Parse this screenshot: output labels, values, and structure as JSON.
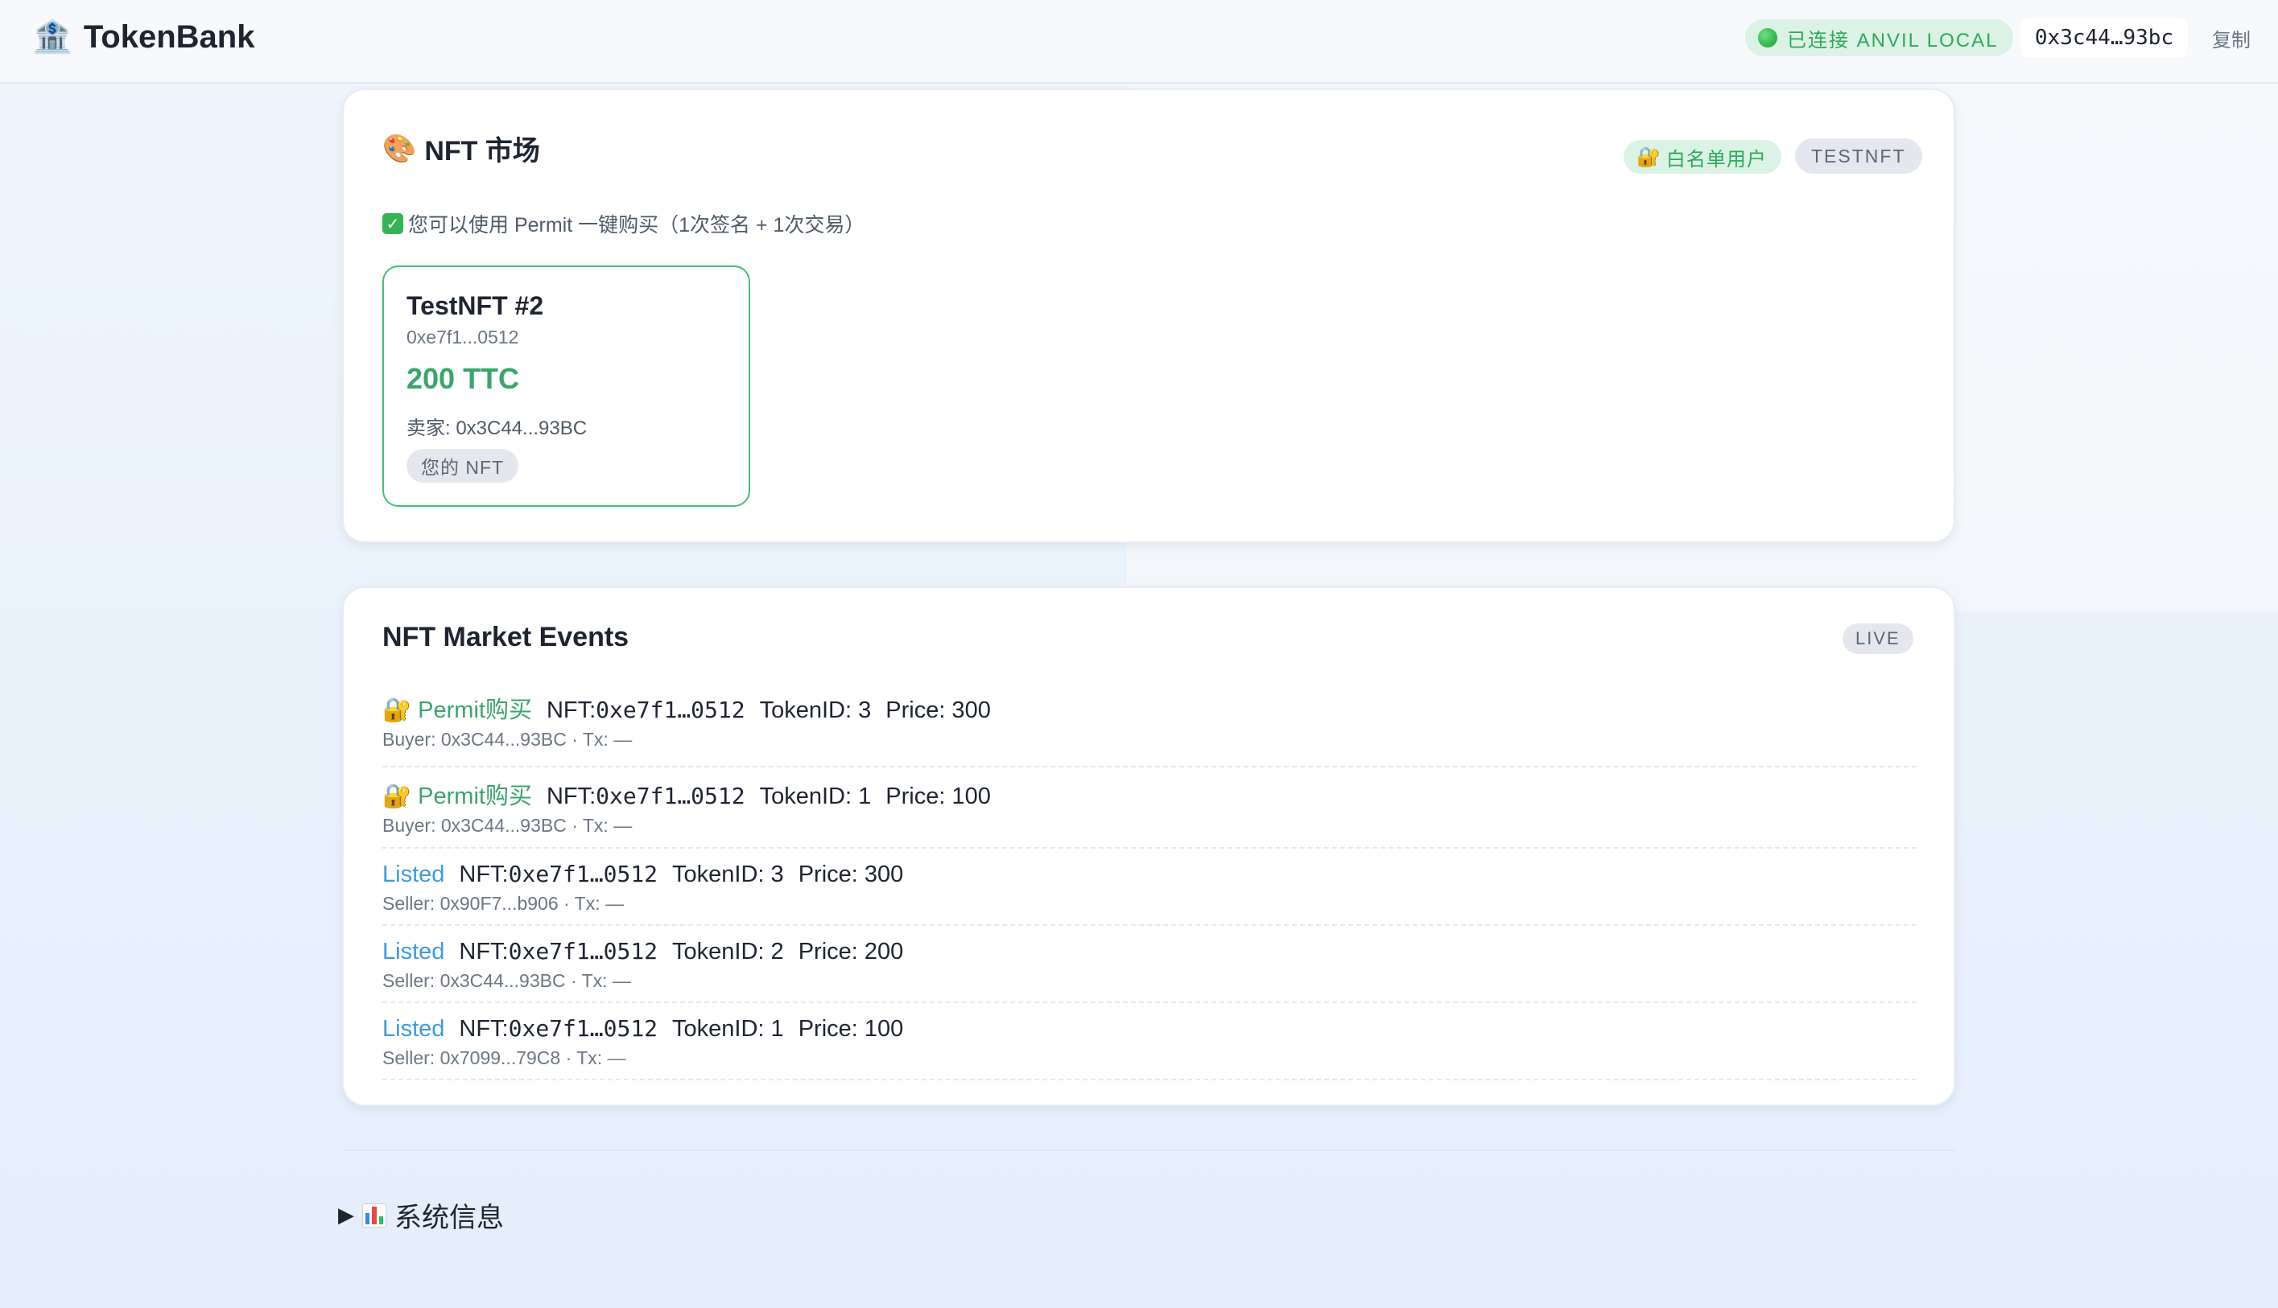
{
  "header": {
    "brand_icon": "🏦",
    "brand_title": "TokenBank",
    "connection_status": "已连接 ANVIL LOCAL",
    "account_address": "0x3c44…93bc",
    "copy_label": "复制"
  },
  "market": {
    "title_icon": "🎨",
    "title": "NFT 市场",
    "whitelist_badge": "白名单用户",
    "whitelist_icon": "🔐",
    "collection_badge": "TESTNFT",
    "permit_note": "您可以使用 Permit 一键购买（1次签名 + 1次交易）",
    "listing": {
      "name": "TestNFT #2",
      "contract": "0xe7f1...0512",
      "price": "200 TTC",
      "seller": "卖家: 0x3C44...93BC",
      "owner_tag": "您的 NFT"
    }
  },
  "events": {
    "title": "NFT Market Events",
    "live_badge": "LIVE",
    "items": [
      {
        "kind": "🔐 Permit购买",
        "nft_label": "NFT: ",
        "nft": "0xe7f1…0512",
        "token": "TokenID: 3",
        "price": "Price: 300",
        "detail": "Buyer: 0x3C44...93BC · Tx: —"
      },
      {
        "kind": "🔐 Permit购买",
        "nft_label": "NFT: ",
        "nft": "0xe7f1…0512",
        "token": "TokenID: 1",
        "price": "Price: 100",
        "detail": "Buyer: 0x3C44...93BC · Tx: —"
      },
      {
        "kind": "Listed",
        "nft_label": "NFT: ",
        "nft": "0xe7f1…0512",
        "token": "TokenID: 3",
        "price": "Price: 300",
        "detail": "Seller: 0x90F7...b906 · Tx: —"
      },
      {
        "kind": "Listed",
        "nft_label": "NFT: ",
        "nft": "0xe7f1…0512",
        "token": "TokenID: 2",
        "price": "Price: 200",
        "detail": "Seller: 0x3C44...93BC · Tx: —"
      },
      {
        "kind": "Listed",
        "nft_label": "NFT: ",
        "nft": "0xe7f1…0512",
        "token": "TokenID: 1",
        "price": "Price: 100",
        "detail": "Seller: 0x7099...79C8 · Tx: —"
      }
    ]
  },
  "system": {
    "toggle_label": "系统信息"
  },
  "colors": {
    "accent_green": "#3aa56a",
    "listed_blue": "#3b9be0",
    "badge_gray": "#e4e8ee"
  }
}
